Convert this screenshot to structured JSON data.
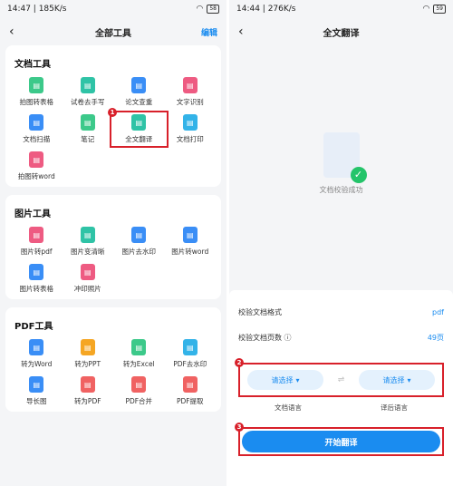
{
  "left": {
    "status": {
      "time_net": "14:47 | 185K/s",
      "battery": "58"
    },
    "nav": {
      "title": "全部工具",
      "edit": "编辑"
    },
    "sections": [
      {
        "title": "文档工具",
        "tools": [
          {
            "label": "拍图转表格",
            "icon": "table-icon",
            "color": "green"
          },
          {
            "label": "试卷去手写",
            "icon": "eraser-icon",
            "color": "teal"
          },
          {
            "label": "论文查重",
            "icon": "doc-check-icon",
            "color": "blue"
          },
          {
            "label": "文字识别",
            "icon": "text-scan-icon",
            "color": "pink"
          },
          {
            "label": "文档扫描",
            "icon": "scan-icon",
            "color": "blue"
          },
          {
            "label": "笔记",
            "icon": "pen-icon",
            "color": "green"
          },
          {
            "label": "全文翻译",
            "icon": "translate-icon",
            "color": "teal",
            "marker": "1"
          },
          {
            "label": "文档打印",
            "icon": "printer-icon",
            "color": "cyan"
          },
          {
            "label": "拍图转word",
            "icon": "word-icon",
            "color": "pink"
          }
        ]
      },
      {
        "title": "图片工具",
        "tools": [
          {
            "label": "图片转pdf",
            "icon": "pdf-icon",
            "color": "pink"
          },
          {
            "label": "图片变清晰",
            "icon": "image-enhance-icon",
            "color": "teal"
          },
          {
            "label": "图片去水印",
            "icon": "image-watermark-icon",
            "color": "blue"
          },
          {
            "label": "图片转word",
            "icon": "image-word-icon",
            "color": "blue"
          },
          {
            "label": "图片转表格",
            "icon": "image-table-icon",
            "color": "blue"
          },
          {
            "label": "冲印照片",
            "icon": "photo-print-icon",
            "color": "pink"
          }
        ]
      },
      {
        "title": "PDF工具",
        "tools": [
          {
            "label": "转为Word",
            "icon": "to-word-icon",
            "color": "blue"
          },
          {
            "label": "转为PPT",
            "icon": "to-ppt-icon",
            "color": "orange"
          },
          {
            "label": "转为Excel",
            "icon": "to-excel-icon",
            "color": "green"
          },
          {
            "label": "PDF去水印",
            "icon": "pdf-watermark-icon",
            "color": "cyan"
          },
          {
            "label": "导长图",
            "icon": "long-image-icon",
            "color": "blue"
          },
          {
            "label": "转为PDF",
            "icon": "to-pdf-icon",
            "color": "red"
          },
          {
            "label": "PDF合并",
            "icon": "pdf-merge-icon",
            "color": "red"
          },
          {
            "label": "PDF提取",
            "icon": "pdf-extract-icon",
            "color": "red"
          }
        ]
      }
    ]
  },
  "right": {
    "status": {
      "time_net": "14:44 | 276K/s",
      "battery": "59"
    },
    "nav": {
      "title": "全文翻译"
    },
    "success_msg": "文档校验成功",
    "rows": [
      {
        "label": "校验文档格式",
        "value": "pdf"
      },
      {
        "label": "校验文档页数",
        "value": "49页"
      }
    ],
    "source_select": "请选择",
    "target_select": "请选择",
    "source_label": "文档语言",
    "target_label": "译后语言",
    "start_button": "开始翻译",
    "markers": {
      "lang": "2",
      "start": "3"
    }
  }
}
